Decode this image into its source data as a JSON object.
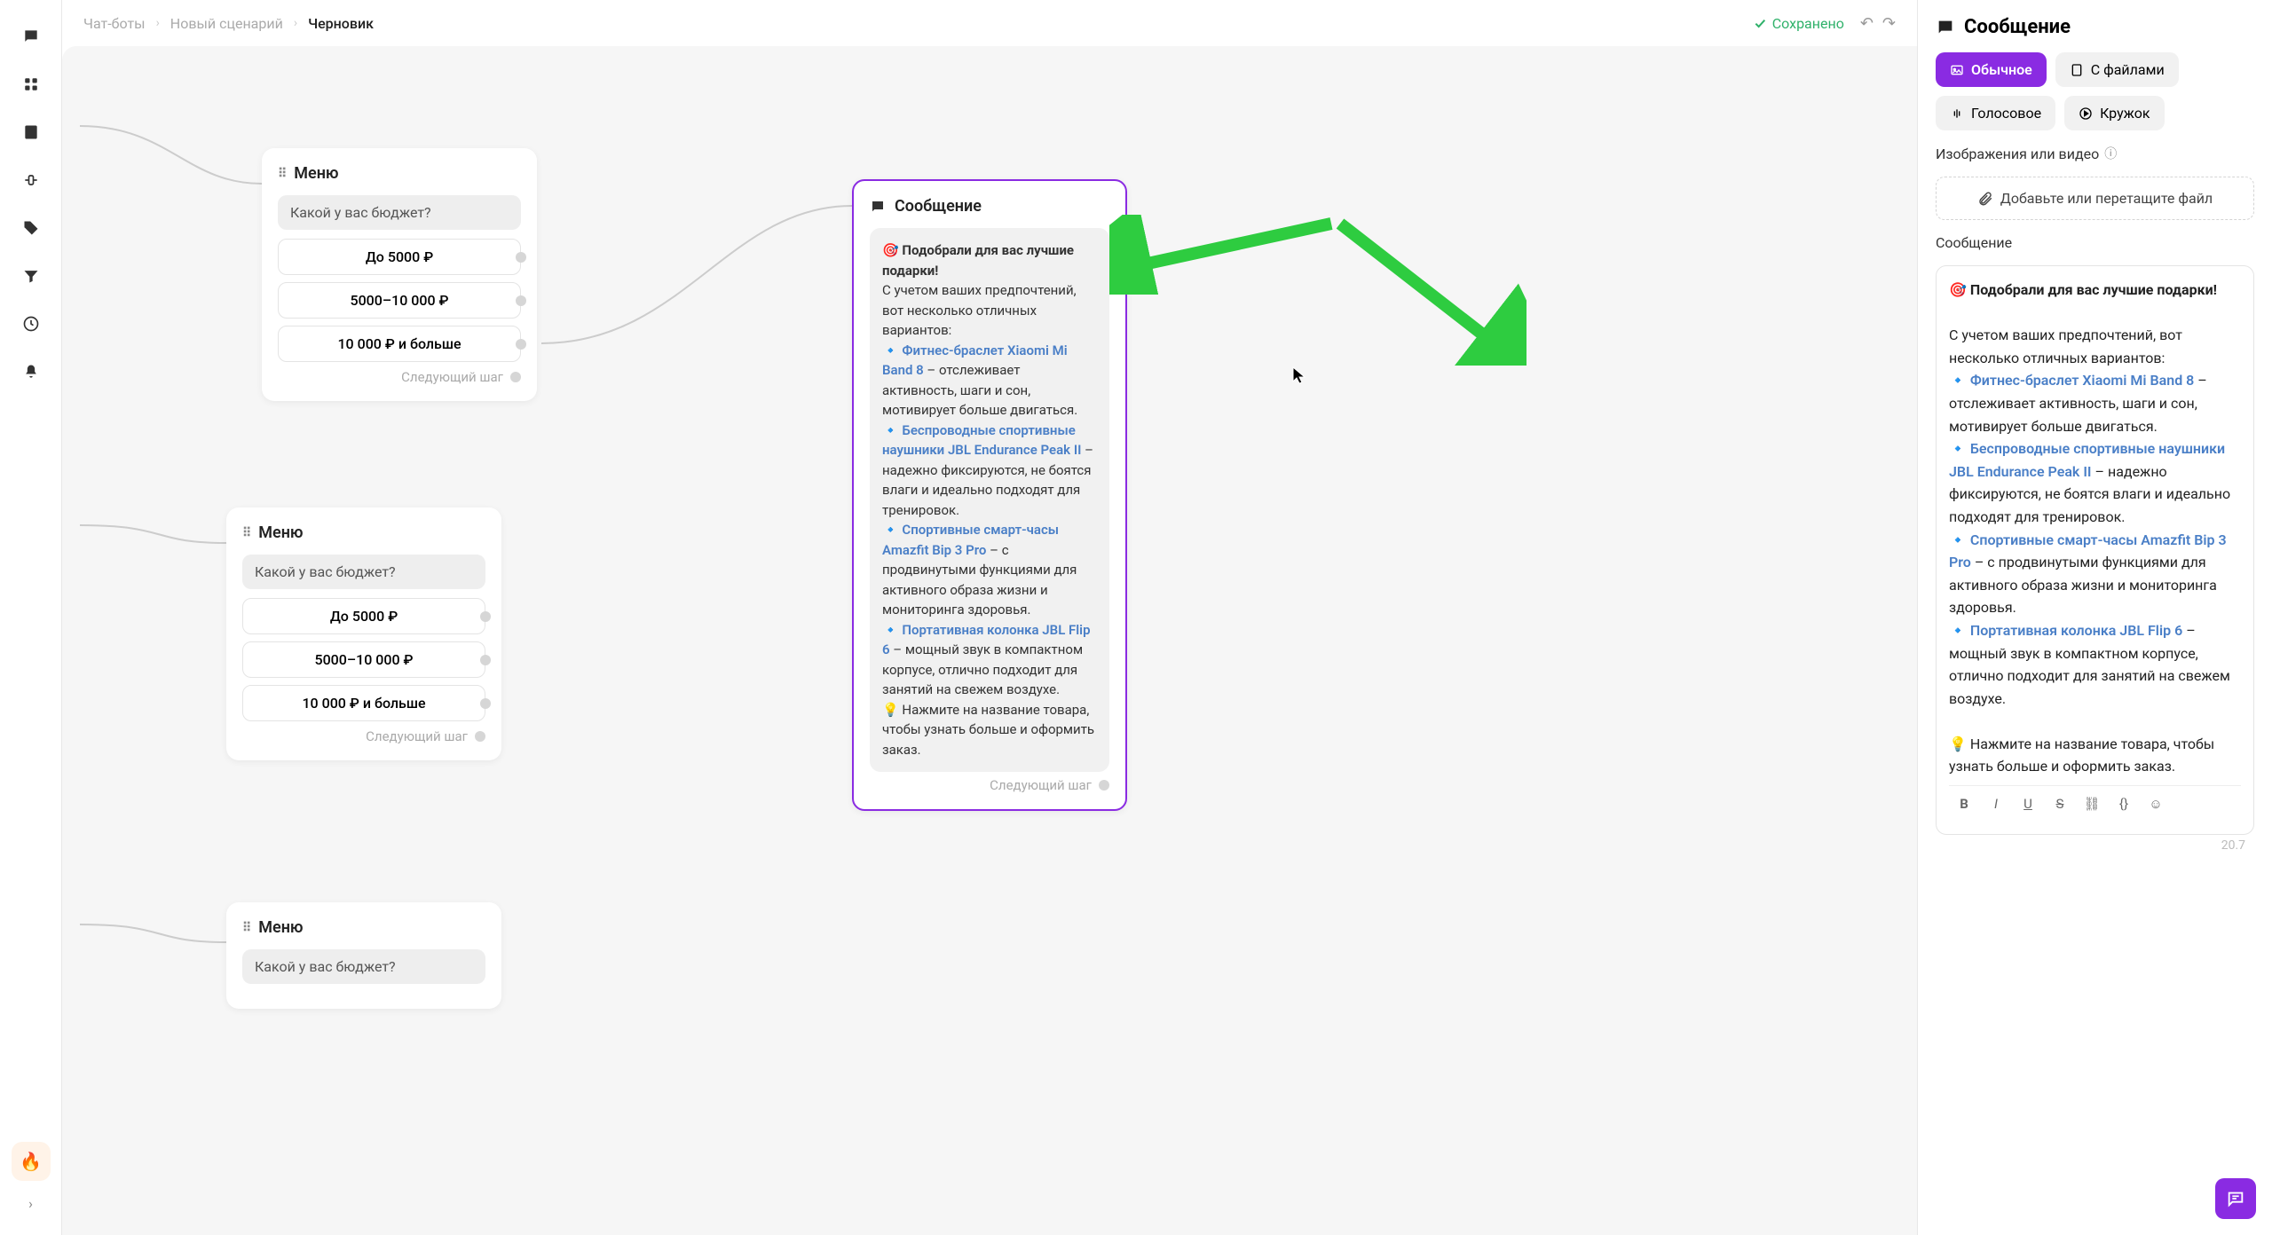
{
  "breadcrumbs": {
    "a": "Чат-боты",
    "b": "Новый сценарий",
    "c": "Черновик"
  },
  "saved_label": "Сохранено",
  "nodes": {
    "menu_label": "Меню",
    "budget_q": "Какой у вас бюджет?",
    "opt1": "До 5000 ₽",
    "opt2": "5000–10 000 ₽",
    "opt3": "10 000 ₽ и больше",
    "next_step": "Следующий шаг",
    "msg_label": "Сообщение"
  },
  "msg": {
    "title_emoji": "🎯",
    "title": "Подобрали для вас лучшие подарки!",
    "intro": "С учетом ваших предпочтений, вот несколько отличных вариантов:",
    "bullet": "🔹",
    "i1_name": "Фитнес-браслет Xiaomi Mi Band 8",
    "i1_desc": " – отслеживает активность, шаги и сон, мотивирует больше двигаться.",
    "i2_name": "Беспроводные спортивные наушники JBL Endurance Peak II",
    "i2_desc": " – надежно фиксируются, не боятся влаги и идеально подходят для тренировок.",
    "i3_name": "Спортивные смарт-часы Amazfit Bip 3 Pro",
    "i3_desc": " – с продвинутыми функциями для активного образа жизни и мониторинга здоровья.",
    "i4_name": "Портативная колонка JBL Flip 6",
    "i4_desc": " – мощный звук в компактном корпусе, отлично подходит для занятий на свежем воздухе.",
    "tip_emoji": "💡",
    "tip": "Нажмите на название товара, чтобы узнать больше и оформить заказ."
  },
  "panel": {
    "title": "Сообщение",
    "tabs": {
      "t1": "Обычное",
      "t2": "С файлами",
      "t3": "Голосовое",
      "t4": "Кружок"
    },
    "img_label": "Изображения или видео",
    "file_drop": "Добавьте или перетащите файл",
    "msg_label": "Сообщение",
    "counter": "20.7"
  }
}
